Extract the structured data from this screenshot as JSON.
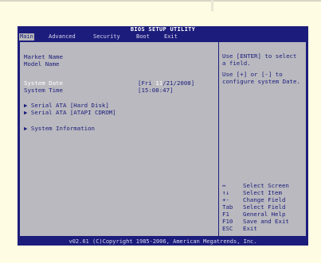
{
  "bios": {
    "title": "BIOS SETUP UTILITY",
    "menu": [
      {
        "label": "Main",
        "active": true
      },
      {
        "label": "Advanced",
        "active": false
      },
      {
        "label": "Security",
        "active": false
      },
      {
        "label": "Boot",
        "active": false
      },
      {
        "label": "Exit",
        "active": false
      }
    ],
    "left": {
      "market_name": "Market Name",
      "model_name": "Model Name",
      "system_date_label": "System Date",
      "system_date_value_prefix": "[Fri ",
      "system_date_value_highlight": "11",
      "system_date_value_suffix": "/21/2008]",
      "system_time_label": "System Time",
      "system_time_value": "[15:08:47]",
      "serial_ata_hdd": "▶ Serial ATA [Hard Disk]",
      "serial_ata_cdrom": "▶ Serial ATA [ATAPI CDROM]",
      "system_information": "▶ System Information"
    },
    "help": {
      "line1": "Use [ENTER] to select",
      "line2": "a field.",
      "line3": "Use [+] or [-] to",
      "line4": "configure system Date."
    },
    "keys": [
      {
        "key": "↔",
        "desc": "Select Screen"
      },
      {
        "key": "↑↓",
        "desc": "Select Item"
      },
      {
        "key": "+-",
        "desc": "Change Field"
      },
      {
        "key": "Tab",
        "desc": "Select Field"
      },
      {
        "key": "F1",
        "desc": "General Help"
      },
      {
        "key": "F10",
        "desc": "Save and Exit"
      },
      {
        "key": "ESC",
        "desc": "Exit"
      }
    ],
    "footer": "v02.61 (C)Copyright 1985-2006, American Megatrends, Inc.",
    "colors": {
      "background": "#1c1c7c",
      "panel": "#b9b9bf",
      "page": "#fefce3",
      "selected_text": "#ffffff"
    }
  }
}
